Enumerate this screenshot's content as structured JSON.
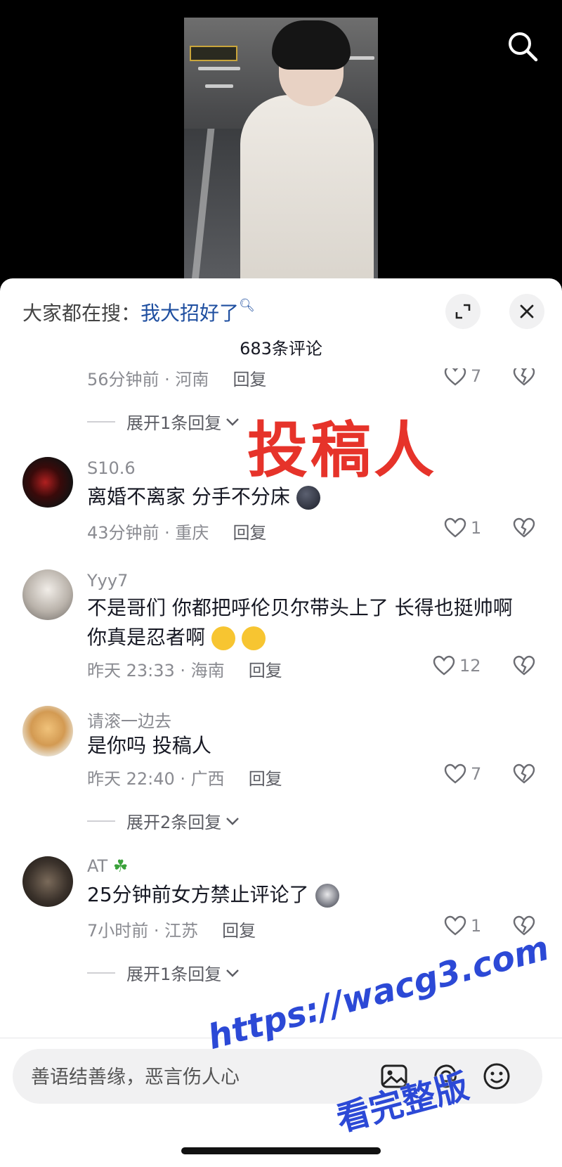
{
  "search_hint": {
    "prefix": "大家都在搜：",
    "term": "我大招好了"
  },
  "comment_count": "683条评论",
  "overlay_label": "投稿人",
  "top_partial": {
    "meta": "56分钟前 · 河南",
    "reply": "回复",
    "likes": "7"
  },
  "expand_replies": [
    "展开1条回复",
    "展开2条回复",
    "展开1条回复"
  ],
  "comments": [
    {
      "username": "S10.6",
      "content": "离婚不离家 分手不分床",
      "meta": "43分钟前 · 重庆",
      "reply": "回复",
      "likes": "1"
    },
    {
      "username": "Yyy7",
      "content": "不是哥们 你都把呼伦贝尔带头上了 长得也挺帅啊 你真是忍者啊",
      "meta": "昨天 23:33 · 海南",
      "reply": "回复",
      "likes": "12"
    },
    {
      "username": "请滚一边去",
      "content": "是你吗 投稿人",
      "meta": "昨天 22:40 · 广西",
      "reply": "回复",
      "likes": "7"
    },
    {
      "username": "AT",
      "content": "25分钟前女方禁止评论了",
      "meta": "7小时前 · 江苏",
      "reply": "回复",
      "likes": "1"
    }
  ],
  "input": {
    "placeholder": "善语结善缘，恶言伤人心"
  },
  "watermark": {
    "url": "https://wacg3.com",
    "sub": "看完整版"
  },
  "colors": {
    "accent_link": "#1f4fa0",
    "overlay_red": "#e6332a",
    "watermark_blue": "#2c49d6"
  }
}
